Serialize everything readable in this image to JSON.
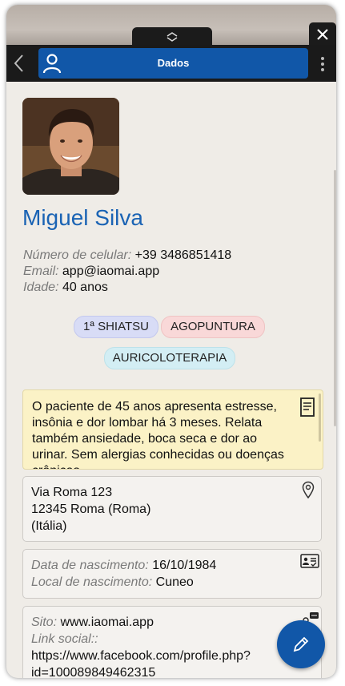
{
  "header": {
    "title": "Dados"
  },
  "profile": {
    "name": "Miguel Silva",
    "phone_label": "Número de celular:",
    "phone": "+39 3486851418",
    "email_label": "Email:",
    "email": "app@iaomai.app",
    "age_label": "Idade:",
    "age": "40 anos"
  },
  "tags": [
    "1ª SHIATSU",
    "AGOPUNTURA",
    "AURICOLOTERAPIA"
  ],
  "notes": {
    "text": "O paciente de 45 anos apresenta estresse, insônia e dor lombar há 3 meses. Relata também ansiedade, boca seca e dor ao urinar. Sem alergias conhecidas ou doenças crônicas."
  },
  "address": {
    "line1": "Via Roma 123",
    "line2": "12345 Roma (Roma)",
    "line3": "(Itália)"
  },
  "birth": {
    "date_label": "Data de nascimento:",
    "date": "16/10/1984",
    "place_label": "Local de nascimento:",
    "place": "Cuneo"
  },
  "web": {
    "site_label": "Sito:",
    "site": "www.iaomai.app",
    "social_label": "Link social::",
    "social_line1": "https://www.facebook.com/profile.php?",
    "social_line2": "id=100089849462315"
  },
  "icons": [
    "chevron-up-down-icon",
    "close-icon",
    "back-icon",
    "person-icon",
    "kebab-menu-icon",
    "document-icon",
    "location-pin-icon",
    "id-card-icon",
    "chat-person-icon",
    "pencil-icon"
  ],
  "colors": {
    "accent": "#1157a8",
    "name": "#1a63b4",
    "header_bg": "#1a1a1a",
    "notes_bg": "#fbf2c6"
  }
}
